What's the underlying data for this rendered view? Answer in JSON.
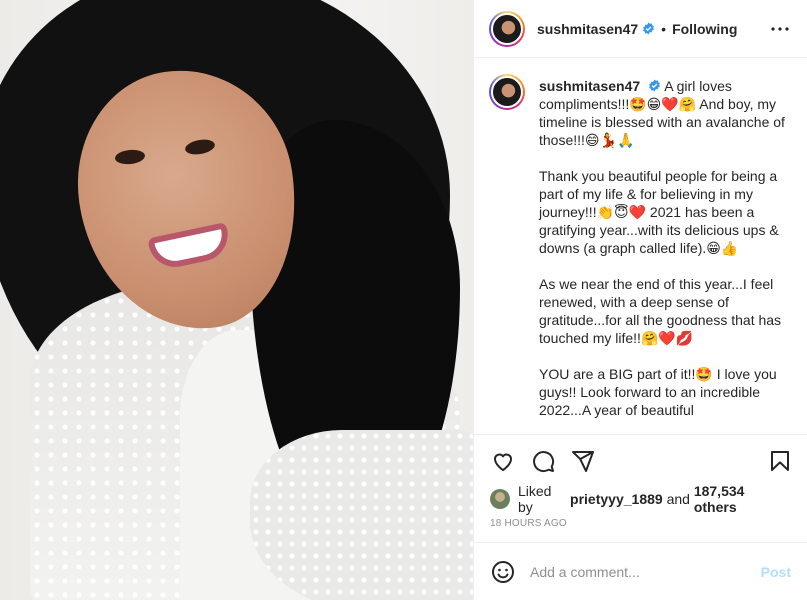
{
  "post": {
    "username": "sushmitasen47",
    "follow_status": "Following",
    "separator": "•",
    "caption": {
      "username": "sushmitasen47",
      "paragraphs": [
        "A girl loves compliments!!!🤩😁❤️🤗 And boy, my timeline is blessed with an avalanche of those!!!😄💃🙏",
        "Thank you beautiful people for being a part of my life & for believing in my journey!!!👏😇❤️ 2021 has been a gratifying year...with its delicious ups & downs (a graph called life).😁👍",
        "As we near the end of this year...I feel renewed, with a deep sense of gratitude...for all the goodness that has touched my life!!🤗❤️💋",
        "YOU are a BIG part of it!!🤩 I love you guys!! Look forward to an incredible 2022...A year of beautiful"
      ]
    },
    "likes": {
      "prefix": "Liked by ",
      "liker": "prietyyy_1889",
      "middle": " and ",
      "others": "187,534 others"
    },
    "timestamp": "18 HOURS AGO",
    "comment": {
      "placeholder": "Add a comment...",
      "post_label": "Post"
    },
    "icons": {
      "header": [
        "verified-badge-icon",
        "more-options-icon"
      ],
      "actions": [
        "heart-icon",
        "comment-icon",
        "share-icon",
        "bookmark-icon"
      ],
      "comment": [
        "emoji-icon"
      ]
    },
    "colors": {
      "verified": "#3897f0",
      "post_disabled": "#b2dffc",
      "secondary_text": "#8e8e8e"
    }
  }
}
